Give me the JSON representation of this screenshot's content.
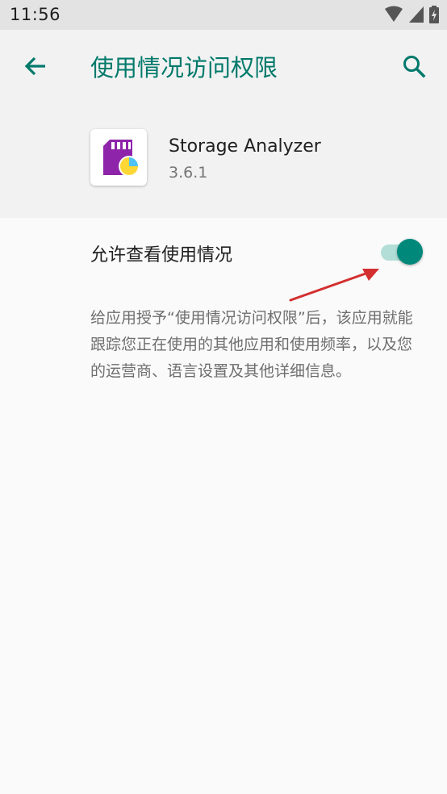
{
  "status_bar": {
    "time": "11:56"
  },
  "header": {
    "title": "使用情况访问权限"
  },
  "app_info": {
    "name": "Storage Analyzer",
    "version": "3.6.1"
  },
  "setting": {
    "label": "允许查看使用情况",
    "enabled": true,
    "summary": "给应用授予“使用情况访问权限”后，该应用就能跟踪您正在使用的其他应用和使用频率，以及您的运营商、语言设置及其他详细信息。"
  },
  "colors": {
    "accent": "#00796b",
    "switch_thumb": "#00897b",
    "switch_track": "#b3ded8",
    "annotation_arrow": "#d32f2f",
    "app_icon_purple": "#8e24aa"
  }
}
